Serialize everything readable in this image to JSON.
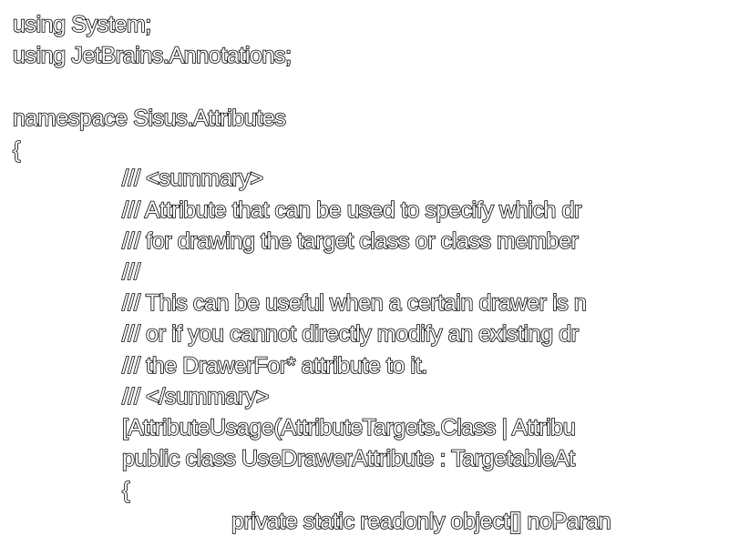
{
  "code": {
    "lines": [
      "using System;",
      "using JetBrains.Annotations;",
      "",
      "namespace Sisus.Attributes",
      "{",
      "/// <summary>",
      "/// Attribute that can be used to specify which dr",
      "/// for drawing the target class or class member",
      "///",
      "/// This can be useful when a certain drawer is n",
      "/// or if you cannot directly modify an existing dr",
      "/// the DrawerFor* attribute to it.",
      "/// </summary>",
      "[AttributeUsage(AttributeTargets.Class | Attribu",
      "public class UseDrawerAttribute : TargetableAt",
      "{",
      "private static readonly object[] noParan"
    ]
  }
}
